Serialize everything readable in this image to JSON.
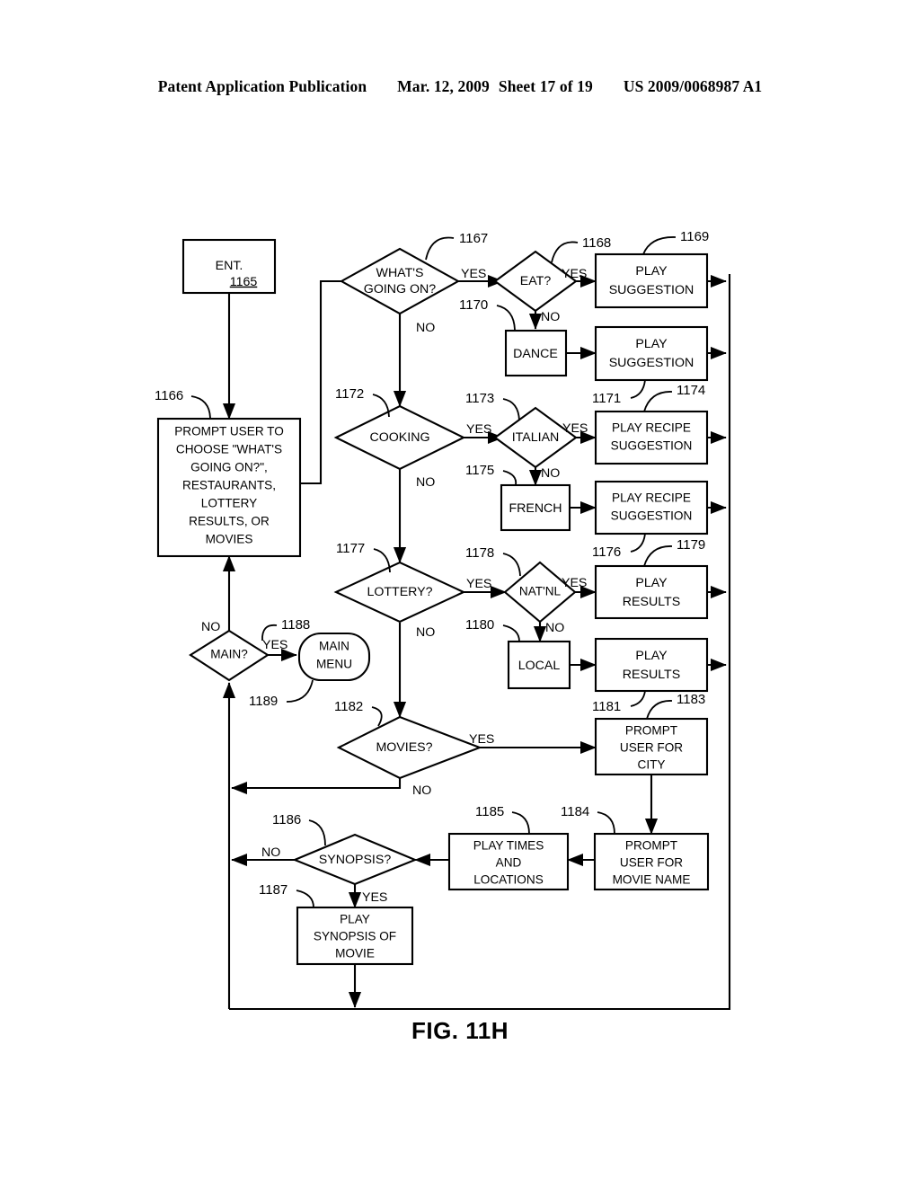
{
  "header": {
    "publication": "Patent Application Publication",
    "date": "Mar. 12, 2009",
    "sheet": "Sheet 17 of 19",
    "patent_number": "US 2009/0068987 A1"
  },
  "figure": {
    "caption": "FIG. 11H"
  },
  "nodes": {
    "ent": {
      "label": "ENT.",
      "ref": "1165"
    },
    "prompt_user_choose": {
      "lines": [
        "PROMPT USER TO",
        "CHOOSE \"WHAT'S",
        "GOING ON?\",",
        "RESTAURANTS,",
        "LOTTERY",
        "RESULTS, OR",
        "MOVIES"
      ],
      "ref": "1166"
    },
    "whats_going_on": {
      "lines": [
        "WHAT'S",
        "GOING ON?"
      ],
      "ref": "1167"
    },
    "eat": {
      "lines": [
        "EAT?"
      ],
      "ref": "1168"
    },
    "play_suggestion_1": {
      "lines": [
        "PLAY",
        "SUGGESTION"
      ],
      "ref": "1169"
    },
    "dance": {
      "lines": [
        "DANCE"
      ],
      "ref": "1170"
    },
    "play_suggestion_2": {
      "lines": [
        "PLAY",
        "SUGGESTION"
      ],
      "ref": "1171"
    },
    "cooking": {
      "lines": [
        "COOKING"
      ],
      "ref": "1172"
    },
    "italian": {
      "lines": [
        "ITALIAN"
      ],
      "ref": "1173"
    },
    "play_recipe_suggestion_1": {
      "lines": [
        "PLAY RECIPE",
        "SUGGESTION"
      ],
      "ref": "1174"
    },
    "french": {
      "lines": [
        "FRENCH"
      ],
      "ref": "1175"
    },
    "play_recipe_suggestion_2": {
      "lines": [
        "PLAY RECIPE",
        "SUGGESTION"
      ],
      "ref": "1176"
    },
    "lottery": {
      "lines": [
        "LOTTERY?"
      ],
      "ref": "1177"
    },
    "natnl": {
      "lines": [
        "NAT'NL"
      ],
      "ref": "1178"
    },
    "play_results_1": {
      "lines": [
        "PLAY",
        "RESULTS"
      ],
      "ref": "1179"
    },
    "local": {
      "lines": [
        "LOCAL"
      ],
      "ref": "1180"
    },
    "play_results_2": {
      "lines": [
        "PLAY",
        "RESULTS"
      ],
      "ref": "1181"
    },
    "movies": {
      "lines": [
        "MOVIES?"
      ],
      "ref": "1182"
    },
    "prompt_user_city": {
      "lines": [
        "PROMPT",
        "USER FOR",
        "CITY"
      ],
      "ref": "1183"
    },
    "prompt_user_movie_name": {
      "lines": [
        "PROMPT",
        "USER FOR",
        "MOVIE NAME"
      ],
      "ref": "1184"
    },
    "play_times_locations": {
      "lines": [
        "PLAY TIMES",
        "AND",
        "LOCATIONS"
      ],
      "ref": "1185"
    },
    "synopsis": {
      "lines": [
        "SYNOPSIS?"
      ],
      "ref": "1186"
    },
    "play_synopsis_of_movie": {
      "lines": [
        "PLAY",
        "SYNOPSIS OF",
        "MOVIE"
      ],
      "ref": "1187"
    },
    "main": {
      "lines": [
        "MAIN?"
      ],
      "ref": null
    },
    "main_menu": {
      "lines": [
        "MAIN",
        "MENU"
      ],
      "ref": "1188",
      "ref2": "1189"
    }
  },
  "edge_labels": {
    "wgo_yes": "YES",
    "wgo_no": "NO",
    "eat_yes": "YES",
    "eat_no": "NO",
    "cooking_yes": "YES",
    "cooking_no": "NO",
    "italian_yes": "YES",
    "italian_no": "NO",
    "lottery_yes": "YES",
    "lottery_no": "NO",
    "natnl_yes": "YES",
    "natnl_no": "NO",
    "movies_yes": "YES",
    "movies_no": "NO",
    "synopsis_no": "NO",
    "synopsis_yes": "YES",
    "main_no": "NO",
    "main_yes": "YES"
  },
  "colors": {
    "ink": "#000000",
    "paper": "#ffffff"
  }
}
